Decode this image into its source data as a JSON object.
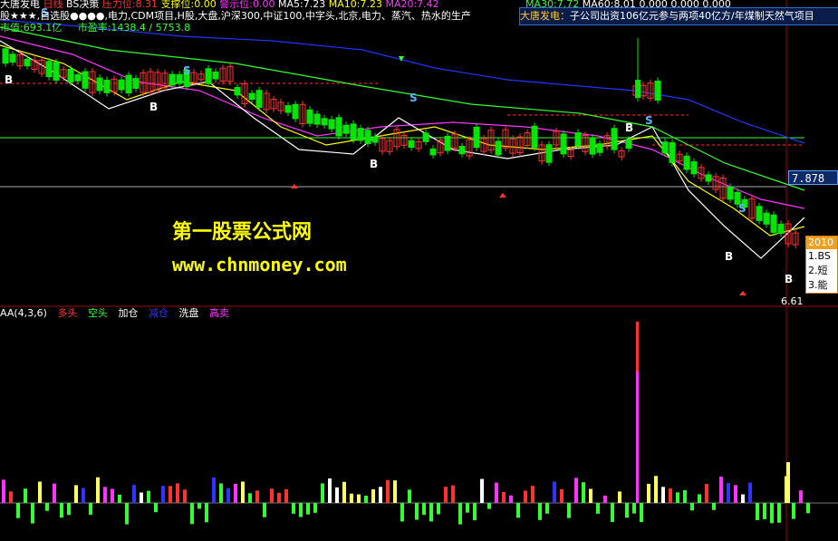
{
  "top_info": {
    "stock_name": "大唐发电",
    "period": "日线",
    "indicator": "BS决策",
    "resistance_label": "压力位:",
    "resistance_value": "8.31",
    "support_label": "支撑位:",
    "support_value": "0.00",
    "watch_label": "警示位:",
    "watch_value": "0.00",
    "ma5_label": "MA5:",
    "ma5_value": "7.23",
    "ma10_label": "MA10:",
    "ma10_value": "7.23",
    "ma20_label": "MA20:",
    "ma20_value": "7.42",
    "ma30_label": "MA30:",
    "ma30_value": "7.72",
    "ma60_label": "MA60:",
    "ma60_value": "8.01",
    "tail_values": "0.000  0.000  0.000"
  },
  "concept_line": "股★★★,自选股●●●●,电力,CDM项目,H股,大盘,沪深300,中证100,中字头,北京,电力、蒸汽、热水的生产",
  "market_line": {
    "circ_value": "市值:693.1亿",
    "pe_value": "市盈率:1438.4 / 5753.8"
  },
  "news": {
    "flag": "大唐发电：",
    "text": "子公司出资106亿元参与两项40亿方/年煤制天然气项目"
  },
  "price_tag": "7.878",
  "low_price": "6.61",
  "popup": {
    "header": "2010",
    "items": [
      "1.BS",
      "2.短",
      "3.能"
    ]
  },
  "watermark": {
    "cn": "第一股票公式网",
    "url": "www.chnmoney.com"
  },
  "sub_panel": {
    "name": "AA(4,3,6)",
    "legend": [
      {
        "label": "多头",
        "color": "#ff3333"
      },
      {
        "label": "空头",
        "color": "#33ff33"
      },
      {
        "label": "加仓",
        "color": "#ffffff"
      },
      {
        "label": "减仓",
        "color": "#3333ff"
      },
      {
        "label": "洗盘",
        "color": "#ffffff"
      },
      {
        "label": "高卖",
        "color": "#ff33ff"
      }
    ]
  },
  "signals": {
    "buy": "B",
    "sell": "S"
  },
  "colors": {
    "up": "#ff3232",
    "down": "#00e600",
    "ma_white": "#ffffff",
    "ma_yellow": "#ffff00",
    "ma_magenta": "#ff33ff",
    "ma_green": "#33ff33",
    "ma_blue": "#2233ff",
    "news_bg": "#0a1c4a"
  }
}
